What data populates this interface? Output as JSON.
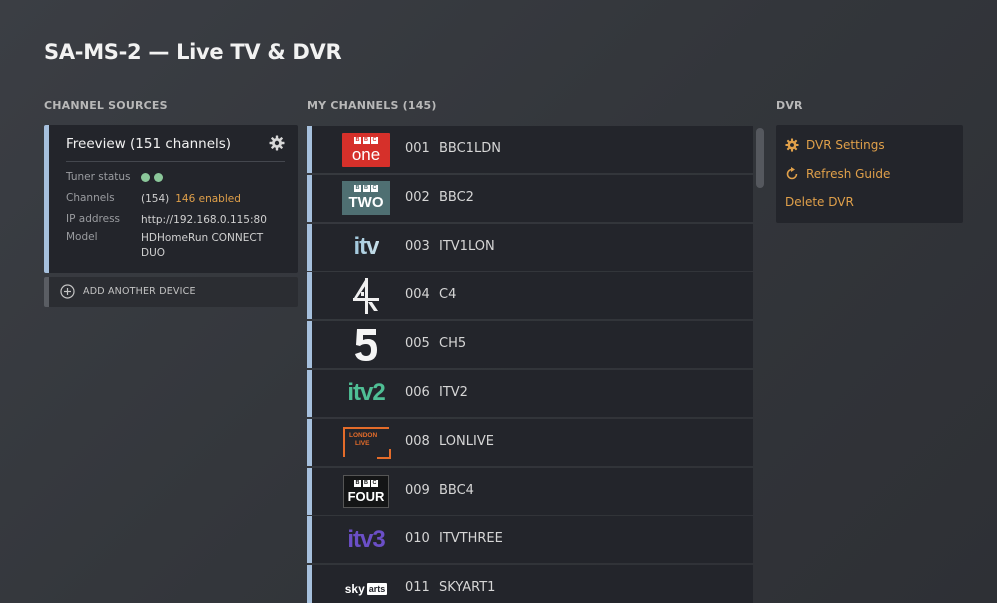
{
  "page": {
    "title": "SA-MS-2 — Live TV & DVR"
  },
  "sections": {
    "sources": "CHANNEL SOURCES",
    "channels": "MY CHANNELS (145)",
    "dvr": "DVR"
  },
  "source": {
    "title": "Freeview (151 channels)",
    "tuner_label": "Tuner status",
    "channels_label": "Channels",
    "channels_count": "(154)",
    "channels_enabled": "146 enabled",
    "ip_label": "IP address",
    "ip_value": "http://192.168.0.115:80",
    "model_label": "Model",
    "model_value_line1": "HDHomeRun CONNECT",
    "model_value_line2": "DUO",
    "tuner_color": "#8bc79a"
  },
  "add_device": {
    "label": "ADD ANOTHER DEVICE"
  },
  "channels": [
    {
      "number": "001",
      "name": "BBC1LDN",
      "logo": "bbc-one",
      "logo_text": "one",
      "logo_brand": "BBC"
    },
    {
      "number": "002",
      "name": "BBC2",
      "logo": "bbc-two",
      "logo_text": "TWO",
      "logo_brand": "BBC"
    },
    {
      "number": "003",
      "name": "ITV1LON",
      "logo": "itv",
      "logo_text": "itv"
    },
    {
      "number": "004",
      "name": "C4",
      "logo": "channel-4",
      "logo_text": "4"
    },
    {
      "number": "005",
      "name": "CH5",
      "logo": "channel-5",
      "logo_text": "5"
    },
    {
      "number": "006",
      "name": "ITV2",
      "logo": "itv2",
      "logo_text": "itv2"
    },
    {
      "number": "008",
      "name": "LONLIVE",
      "logo": "london-live",
      "logo_text_line1": "LONDON",
      "logo_text_line2": "LIVE"
    },
    {
      "number": "009",
      "name": "BBC4",
      "logo": "bbc-four",
      "logo_text": "FOUR",
      "logo_brand": "BBC"
    },
    {
      "number": "010",
      "name": "ITVTHREE",
      "logo": "itv3",
      "logo_text": "itv3"
    },
    {
      "number": "011",
      "name": "SKYART1",
      "logo": "sky-arts",
      "logo_text": "sky",
      "logo_text_2": "arts"
    }
  ],
  "dvr": {
    "settings": "DVR Settings",
    "refresh": "Refresh Guide",
    "delete": "Delete DVR"
  },
  "colors": {
    "accent": "#e0a04a",
    "card_border": "#a6c0dd",
    "card_bg": "#23252b"
  }
}
